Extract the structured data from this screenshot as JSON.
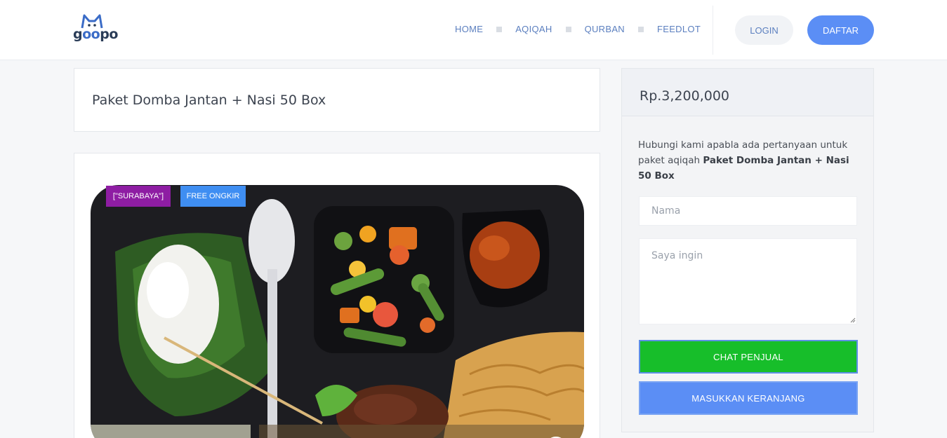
{
  "header": {
    "logo_text": "goopo",
    "nav": [
      "HOME",
      "AQIQAH",
      "QURBAN",
      "FEEDLOT"
    ],
    "login_label": "LOGIN",
    "register_label": "DAFTAR"
  },
  "product": {
    "title": "Paket Domba Jantan + Nasi 50 Box",
    "tags": [
      "[\"SURABAYA\"]",
      "FREE ONGKIR"
    ]
  },
  "sidebar": {
    "price": "Rp.3,200,000",
    "info_text": "Hubungi kami apabla ada pertanyaan untuk paket aqiqah ",
    "info_product": "Paket Domba Jantan + Nasi 50 Box",
    "name_placeholder": "Nama",
    "message_placeholder": "Saya ingin",
    "chat_button": "CHAT PENJUAL",
    "cart_button": "MASUKKAN KERANJANG"
  },
  "colors": {
    "primary": "#5b8ef5",
    "chat_green": "#17be2a",
    "city_tag": "#8e1da3",
    "free_tag": "#3f8ef2"
  }
}
